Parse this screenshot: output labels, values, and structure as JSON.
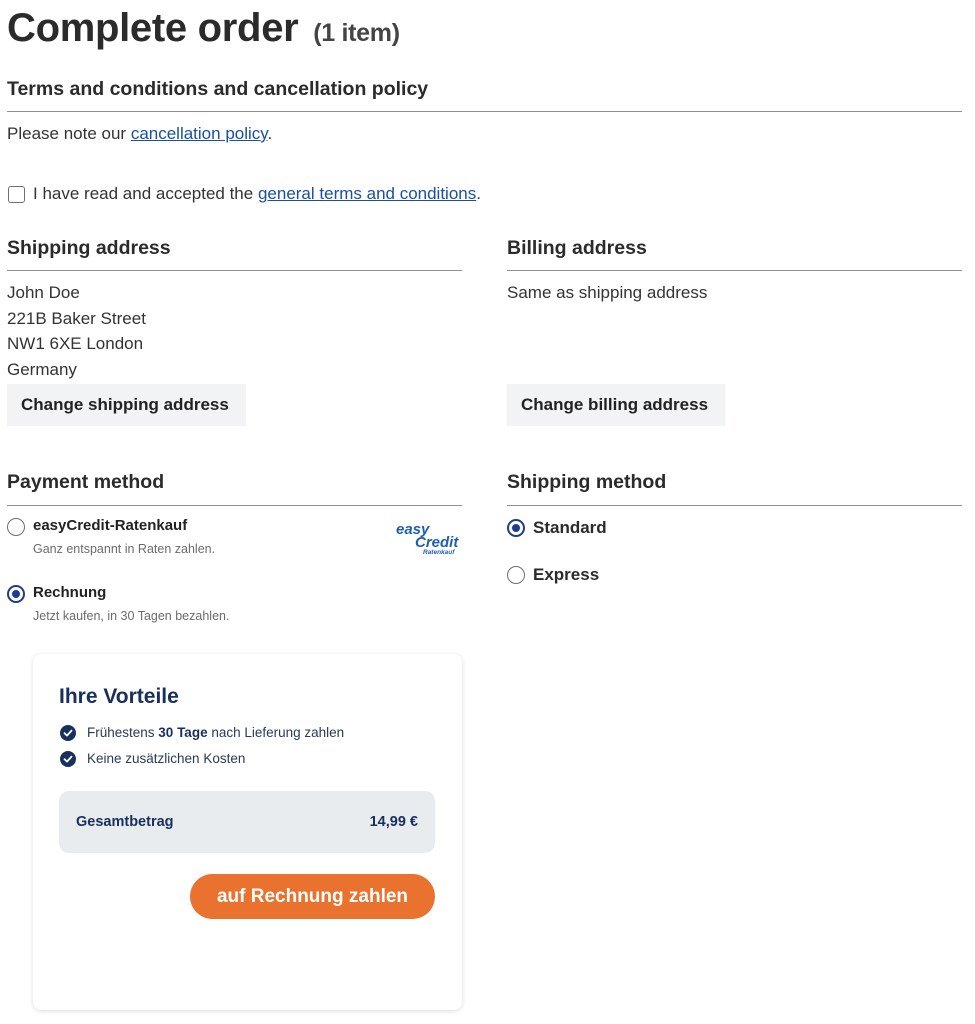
{
  "page": {
    "title": "Complete order",
    "item_count": "(1 item)"
  },
  "terms": {
    "heading": "Terms and conditions and cancellation policy",
    "note_prefix": "Please note our ",
    "note_link": "cancellation policy",
    "note_suffix": ".",
    "accept_checked": false,
    "accept_prefix": "I have read and accepted the ",
    "accept_link": "general terms and conditions",
    "accept_suffix": "."
  },
  "shipping_address": {
    "heading": "Shipping address",
    "lines": [
      "John Doe",
      "221B Baker Street",
      "NW1 6XE London",
      "Germany"
    ],
    "change_label": "Change shipping address"
  },
  "billing_address": {
    "heading": "Billing address",
    "text": "Same as shipping address",
    "change_label": "Change billing address"
  },
  "payment": {
    "heading": "Payment method",
    "options": [
      {
        "title": "easyCredit-Ratenkauf",
        "desc": "Ganz entspannt in Raten zahlen.",
        "selected": false,
        "logo": "easyCredit-logo",
        "logo_text": [
          "easy",
          "Credit",
          "Ratenkauf"
        ]
      },
      {
        "title": "Rechnung",
        "desc": "Jetzt kaufen, in 30 Tagen bezahlen.",
        "selected": true
      }
    ]
  },
  "shipping_method": {
    "heading": "Shipping method",
    "options": [
      {
        "label": "Standard",
        "selected": true
      },
      {
        "label": "Express",
        "selected": false
      }
    ]
  },
  "invoice_card": {
    "title": "Ihre Vorteile",
    "benefits": [
      {
        "prefix": "Frühestens ",
        "bold": "30 Tage",
        "suffix": " nach Lieferung zahlen"
      },
      {
        "prefix": "Keine zusätzlichen Kosten",
        "bold": "",
        "suffix": ""
      }
    ],
    "total_label": "Gesamtbetrag",
    "total_value": "14,99 €",
    "pay_button": "auf Rechnung zahlen"
  },
  "colors": {
    "link": "#1a4fa3",
    "radio_selected": "#1d3d8f",
    "card_navy": "#17305c",
    "pay_button": "#e9722e"
  }
}
